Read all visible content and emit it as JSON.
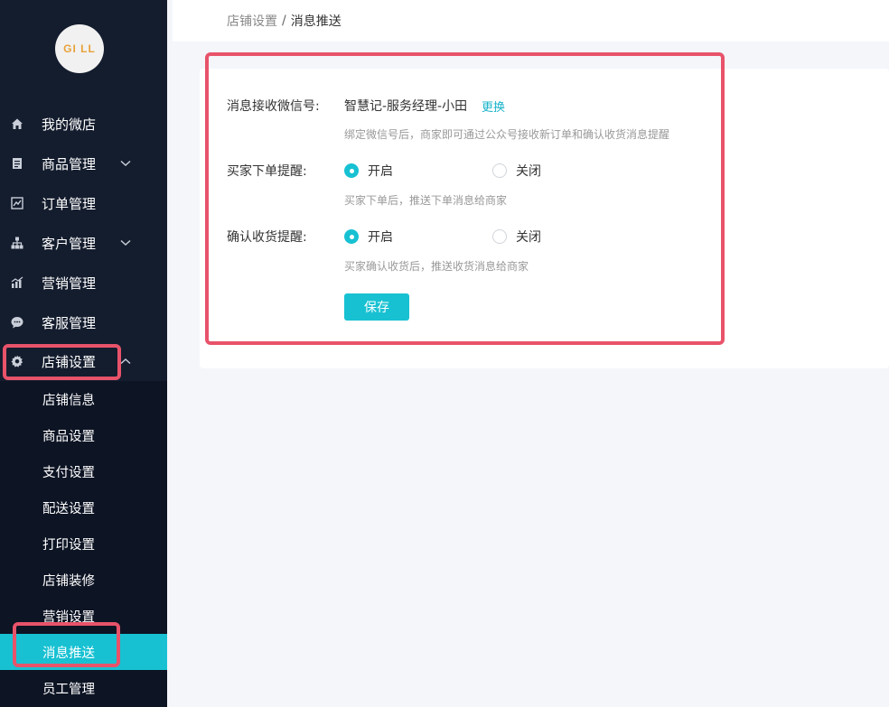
{
  "sidebar": {
    "logo_text": "GI",
    "logo_text2": "LL",
    "items": [
      {
        "label": "我的微店",
        "icon": "home-icon"
      },
      {
        "label": "商品管理",
        "icon": "document-icon"
      },
      {
        "label": "订单管理",
        "icon": "chart-icon"
      },
      {
        "label": "客户管理",
        "icon": "org-icon"
      },
      {
        "label": "营销管理",
        "icon": "bar-chart-icon"
      },
      {
        "label": "客服管理",
        "icon": "chat-icon"
      },
      {
        "label": "店铺设置",
        "icon": "gear-icon"
      }
    ],
    "submenu": [
      {
        "label": "店铺信息"
      },
      {
        "label": "商品设置"
      },
      {
        "label": "支付设置"
      },
      {
        "label": "配送设置"
      },
      {
        "label": "打印设置"
      },
      {
        "label": "店铺装修"
      },
      {
        "label": "营销设置"
      },
      {
        "label": "消息推送"
      },
      {
        "label": "员工管理"
      }
    ]
  },
  "breadcrumb": {
    "parent": "店铺设置",
    "separator": "/",
    "current": "消息推送"
  },
  "form": {
    "wechat_label": "消息接收微信号:",
    "wechat_value": "智慧记-服务经理-小田",
    "change_link": "更换",
    "wechat_hint": "绑定微信号后，商家即可通过公众号接收新订单和确认收货消息提醒",
    "order_label": "买家下单提醒:",
    "order_on": "开启",
    "order_off": "关闭",
    "order_hint": "买家下单后，推送下单消息给商家",
    "receipt_label": "确认收货提醒:",
    "receipt_on": "开启",
    "receipt_off": "关闭",
    "receipt_hint": "买家确认收货后，推送收货消息给商家",
    "save_label": "保存"
  },
  "colors": {
    "accent": "#17c1d2",
    "sidebar_bg": "#141d2e",
    "highlight": "#e8536a"
  }
}
